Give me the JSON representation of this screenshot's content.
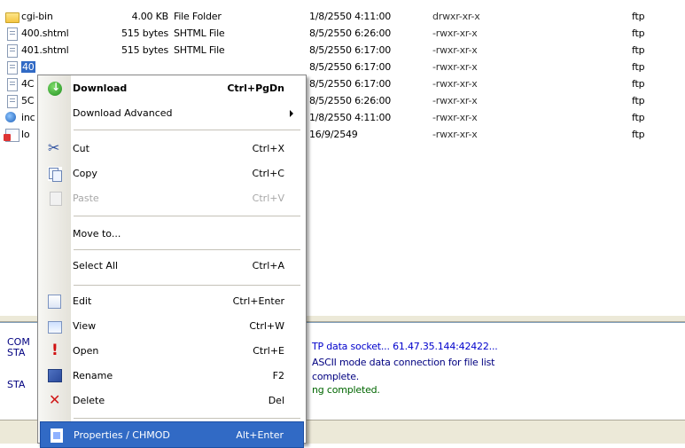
{
  "files": [
    {
      "icon": "folder-icon",
      "name": "cgi-bin",
      "size": "4.00 KB",
      "type": "File Folder",
      "date": "1/8/2550 4:11:00",
      "perm": "drwxr-xr-x",
      "owner": "ftp"
    },
    {
      "icon": "file-icon",
      "name": "400.shtml",
      "size": "515 bytes",
      "type": "SHTML File",
      "date": "8/5/2550 6:26:00",
      "perm": "-rwxr-xr-x",
      "owner": "ftp"
    },
    {
      "icon": "file-icon",
      "name": "401.shtml",
      "size": "515 bytes",
      "type": "SHTML File",
      "date": "8/5/2550 6:17:00",
      "perm": "-rwxr-xr-x",
      "owner": "ftp"
    },
    {
      "icon": "file-icon",
      "name": "40",
      "size": "",
      "type": "",
      "date": "8/5/2550 6:17:00",
      "perm": "-rwxr-xr-x",
      "owner": "ftp"
    },
    {
      "icon": "file-icon",
      "name": "4C",
      "size": "",
      "type": "",
      "date": "8/5/2550 6:17:00",
      "perm": "-rwxr-xr-x",
      "owner": "ftp"
    },
    {
      "icon": "file-icon",
      "name": "5C",
      "size": "",
      "type": "",
      "date": "8/5/2550 6:26:00",
      "perm": "-rwxr-xr-x",
      "owner": "ftp"
    },
    {
      "icon": "html-icon",
      "name": "inc",
      "size": "",
      "type": "",
      "date": "1/8/2550 4:11:00",
      "perm": "-rwxr-xr-x",
      "owner": "ftp"
    },
    {
      "icon": "log-icon",
      "name": "lo",
      "size": "",
      "type": "",
      "date": "16/9/2549",
      "perm": "-rwxr-xr-x",
      "owner": "ftp"
    }
  ],
  "log": {
    "prefixes": [
      "COM",
      "STA",
      "STA"
    ],
    "lines": [
      "TP data socket... 61.47.35.144:42422...",
      "ASCII mode data connection for file list",
      "complete.",
      "ng completed."
    ]
  },
  "menu": {
    "download": {
      "label": "Download",
      "shortcut": "Ctrl+PgDn"
    },
    "download_advanced": {
      "label": "Download Advanced"
    },
    "cut": {
      "label": "Cut",
      "shortcut": "Ctrl+X"
    },
    "copy": {
      "label": "Copy",
      "shortcut": "Ctrl+C"
    },
    "paste": {
      "label": "Paste",
      "shortcut": "Ctrl+V"
    },
    "move_to": {
      "label": "Move to..."
    },
    "select_all": {
      "label": "Select All",
      "shortcut": "Ctrl+A"
    },
    "edit": {
      "label": "Edit",
      "shortcut": "Ctrl+Enter"
    },
    "view": {
      "label": "View",
      "shortcut": "Ctrl+W"
    },
    "open": {
      "label": "Open",
      "shortcut": "Ctrl+E"
    },
    "rename": {
      "label": "Rename",
      "shortcut": "F2"
    },
    "delete": {
      "label": "Delete",
      "shortcut": "Del"
    },
    "properties": {
      "label": "Properties / CHMOD",
      "shortcut": "Alt+Enter"
    }
  },
  "colors": {
    "selection": "#316ac5",
    "log_blue": "#0000cc",
    "log_green": "#006600"
  }
}
